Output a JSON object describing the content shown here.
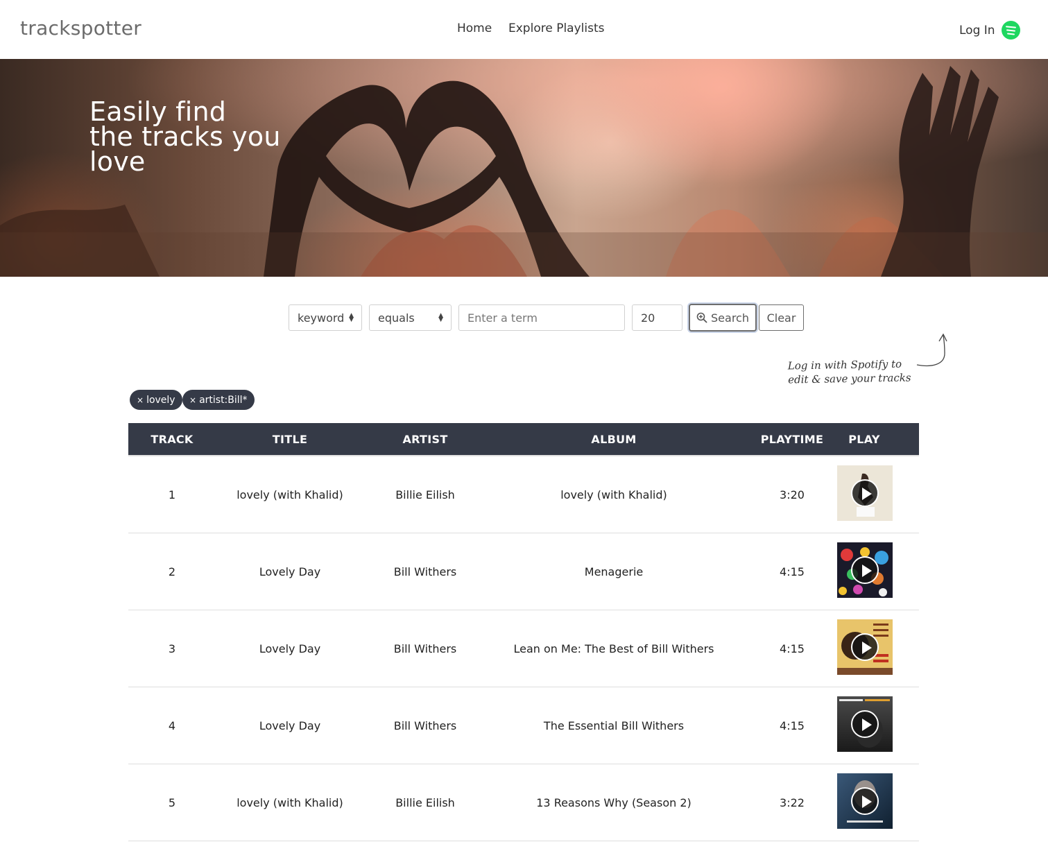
{
  "header": {
    "logo": "trackspotter",
    "nav": [
      "Home",
      "Explore Playlists"
    ],
    "login_label": "Log In",
    "login_icon": "spotify-icon"
  },
  "hero": {
    "title_lines": [
      "Easily find",
      "the tracks you",
      "love"
    ]
  },
  "search": {
    "field_select": "keyword",
    "operator_select": "equals",
    "term_placeholder": "Enter a term",
    "limit_value": "20",
    "search_label": "Search",
    "search_icon": "zoom-in-icon",
    "clear_label": "Clear",
    "hint_lines": [
      "Log in with Spotify to",
      "edit & save your tracks"
    ]
  },
  "chips": [
    "lovely",
    "artist:Bill*"
  ],
  "table": {
    "headers": [
      "TRACK",
      "TITLE",
      "ARTIST",
      "ALBUM",
      "PLAYTIME",
      "PLAY"
    ],
    "rows": [
      {
        "track": "1",
        "title": "lovely (with Khalid)",
        "artist": "Billie Eilish",
        "album": "lovely (with Khalid)",
        "playtime": "3:20"
      },
      {
        "track": "2",
        "title": "Lovely Day",
        "artist": "Bill Withers",
        "album": "Menagerie",
        "playtime": "4:15"
      },
      {
        "track": "3",
        "title": "Lovely Day",
        "artist": "Bill Withers",
        "album": "Lean on Me: The Best of Bill Withers",
        "playtime": "4:15"
      },
      {
        "track": "4",
        "title": "Lovely Day",
        "artist": "Bill Withers",
        "album": "The Essential Bill Withers",
        "playtime": "4:15"
      },
      {
        "track": "5",
        "title": "lovely (with Khalid)",
        "artist": "Billie Eilish",
        "album": "13 Reasons Why (Season 2)",
        "playtime": "3:22"
      }
    ]
  },
  "colors": {
    "table_header_bg": "#353a47",
    "chip_bg": "#353a47",
    "spotify_green": "#1ed760"
  }
}
